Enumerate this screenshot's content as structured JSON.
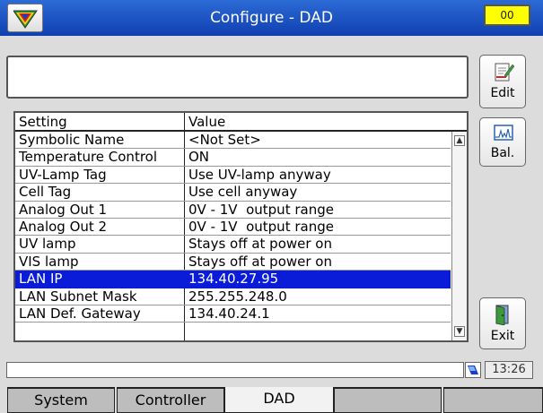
{
  "window": {
    "title": "Configure - DAD",
    "status_indicator": "00",
    "status_color": "#ffff00"
  },
  "message_box": {
    "text": ""
  },
  "side_buttons": {
    "edit_label": "Edit",
    "edit_icon": "edit-icon",
    "bal_label": "Bal.",
    "bal_icon": "chromatogram-icon",
    "exit_label": "Exit",
    "exit_icon": "door-exit-icon"
  },
  "table": {
    "columns": [
      "Setting",
      "Value"
    ],
    "rows": [
      {
        "setting": "Symbolic Name",
        "value": "<Not Set>"
      },
      {
        "setting": "Temperature Control",
        "value": "ON"
      },
      {
        "setting": "UV-Lamp Tag",
        "value": "Use UV-lamp anyway"
      },
      {
        "setting": "Cell Tag",
        "value": "Use cell anyway"
      },
      {
        "setting": "Analog Out 1",
        "value": "0V - 1V  output range"
      },
      {
        "setting": "Analog Out 2",
        "value": "0V - 1V  output range"
      },
      {
        "setting": "UV lamp",
        "value": "Stays off at power on"
      },
      {
        "setting": "VIS lamp",
        "value": "Stays off at power on"
      },
      {
        "setting": "LAN IP",
        "value": "134.40.27.95"
      },
      {
        "setting": "LAN Subnet Mask",
        "value": "255.255.248.0"
      },
      {
        "setting": "LAN Def. Gateway",
        "value": "134.40.24.1"
      }
    ],
    "selected_row": "LAN IP",
    "selection_color": "#0a1cd8"
  },
  "status_bar": {
    "text": "",
    "time": "13:26",
    "network_icon": "network-icon"
  },
  "tabs": [
    {
      "label": "System",
      "active": false
    },
    {
      "label": "Controller",
      "active": false
    },
    {
      "label": "DAD",
      "active": true
    },
    {
      "label": "",
      "active": false
    },
    {
      "label": "",
      "active": false
    }
  ],
  "colors": {
    "title_bar": "#1a55c8",
    "background": "#dcdcdc"
  }
}
